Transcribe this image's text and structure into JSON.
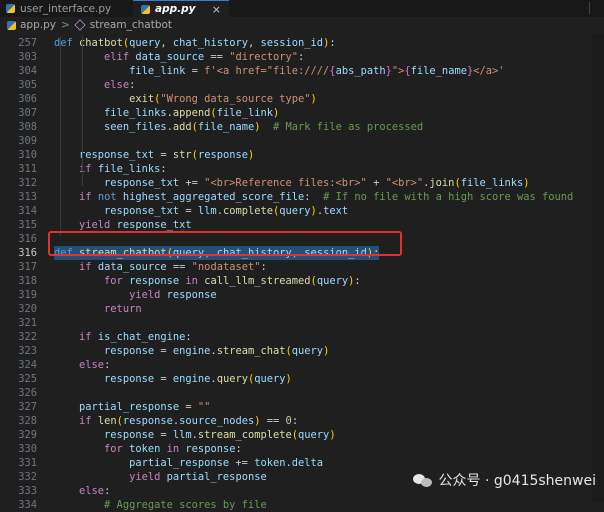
{
  "tabs": [
    {
      "label": "user_interface.py",
      "active": false
    },
    {
      "label": "app.py",
      "active": true,
      "close": "×"
    }
  ],
  "breadcrumb": {
    "file": "app.py",
    "separator": ">",
    "symbol": "stream_chatbot"
  },
  "sticky_line": {
    "number": "257",
    "code": "def chatbot(query, chat_history, session_id):"
  },
  "lines": [
    {
      "n": "303",
      "code": "        elif data_source == \"directory\":"
    },
    {
      "n": "304",
      "code": "            file_link = f'<a href=\"file:////{abs_path}\">{file_name}</a>'"
    },
    {
      "n": "305",
      "code": "        else:"
    },
    {
      "n": "306",
      "code": "            exit(\"Wrong data_source type\")"
    },
    {
      "n": "307",
      "code": "        file_links.append(file_link)"
    },
    {
      "n": "308",
      "code": "        seen_files.add(file_name)  # Mark file as processed"
    },
    {
      "n": "309",
      "code": ""
    },
    {
      "n": "310",
      "code": "    response_txt = str(response)"
    },
    {
      "n": "311",
      "code": "    if file_links:"
    },
    {
      "n": "312",
      "code": "        response_txt += \"<br>Reference files:<br>\" + \"<br>\".join(file_links)"
    },
    {
      "n": "313",
      "code": "    if not highest_aggregated_score_file:  # If no file with a high score was found"
    },
    {
      "n": "314",
      "code": "        response_txt = llm.complete(query).text"
    },
    {
      "n": "315",
      "code": "    yield response_txt"
    },
    {
      "n": "316",
      "code": ""
    },
    {
      "n": "316",
      "code": "def stream_chatbot(query, chat_history, session_id):"
    },
    {
      "n": "317",
      "code": "    if data_source == \"nodataset\":"
    },
    {
      "n": "318",
      "code": "        for response in call_llm_streamed(query):"
    },
    {
      "n": "319",
      "code": "            yield response"
    },
    {
      "n": "320",
      "code": "        return"
    },
    {
      "n": "321",
      "code": ""
    },
    {
      "n": "322",
      "code": "    if is_chat_engine:"
    },
    {
      "n": "323",
      "code": "        response = engine.stream_chat(query)"
    },
    {
      "n": "324",
      "code": "    else:"
    },
    {
      "n": "325",
      "code": "        response = engine.query(query)"
    },
    {
      "n": "326",
      "code": ""
    },
    {
      "n": "327",
      "code": "    partial_response = \"\""
    },
    {
      "n": "328",
      "code": "    if len(response.source_nodes) == 0:"
    },
    {
      "n": "329",
      "code": "        response = llm.stream_complete(query)"
    },
    {
      "n": "330",
      "code": "        for token in response:"
    },
    {
      "n": "331",
      "code": "            partial_response += token.delta"
    },
    {
      "n": "332",
      "code": "            yield partial_response"
    },
    {
      "n": "333",
      "code": "    else:"
    },
    {
      "n": "334",
      "code": "        # Aggregate scores by file"
    }
  ],
  "watermark": {
    "text": "公众号 · g0415shenwei"
  },
  "colors": {
    "highlight_border": "#e0332d",
    "selection": "#264f78",
    "background": "#1f1f1f"
  }
}
